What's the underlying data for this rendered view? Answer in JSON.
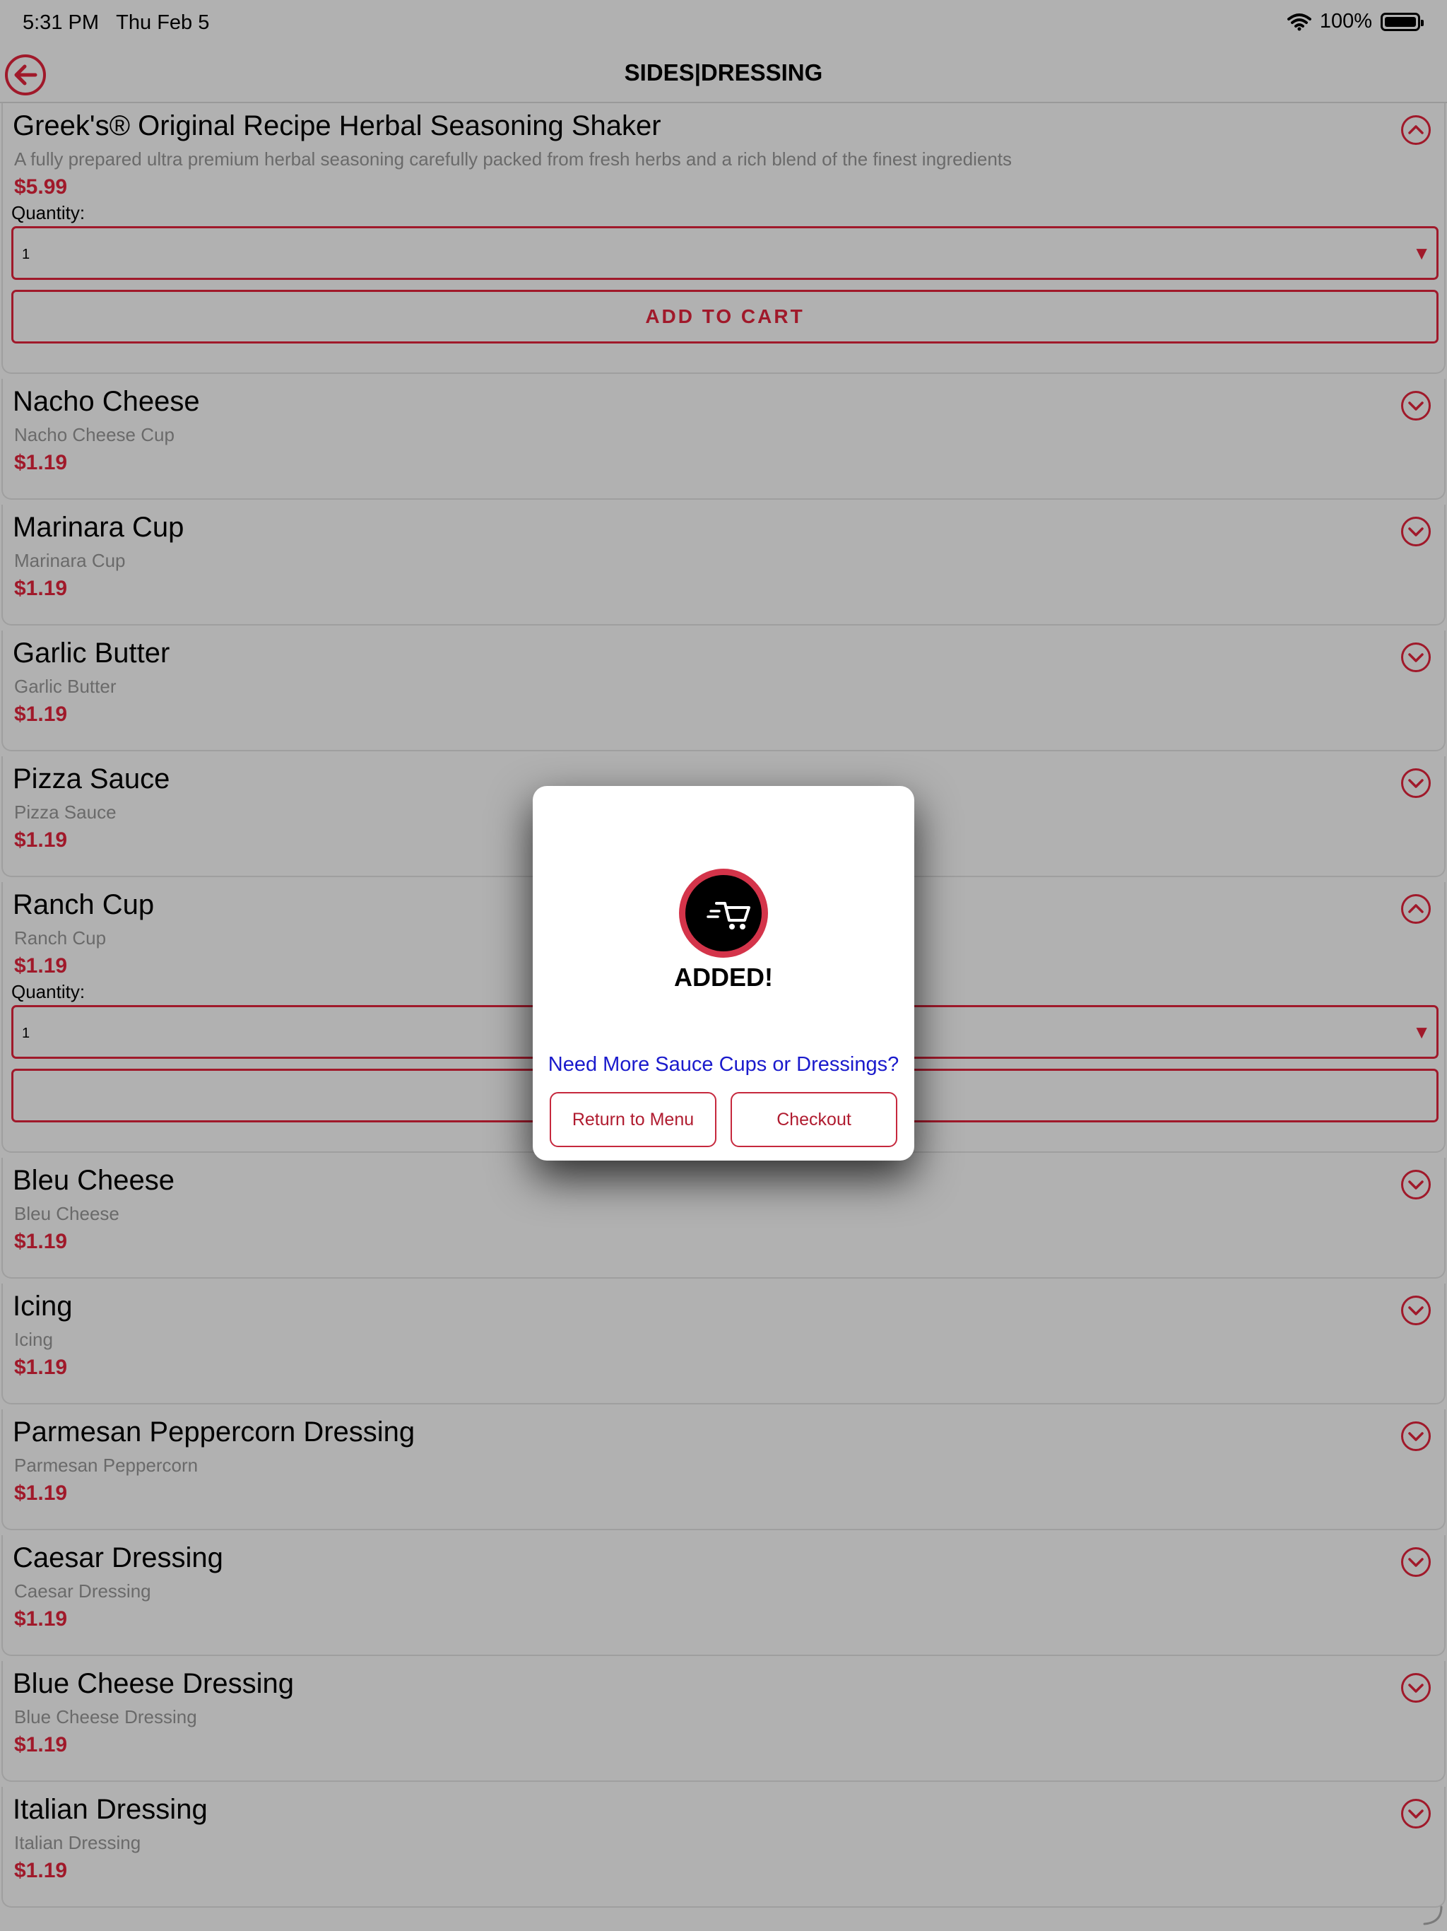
{
  "status_bar": {
    "time": "5:31 PM",
    "date": "Thu Feb 5",
    "battery": "100%"
  },
  "nav": {
    "title": "SIDES|DRESSING",
    "back_icon": "back-arrow-icon"
  },
  "items": [
    {
      "name": "Greek's® Original Recipe Herbal Seasoning Shaker",
      "desc": "A fully prepared ultra premium herbal seasoning carefully packed from fresh herbs and a rich blend of the finest ingredients",
      "price": "$5.99",
      "expanded": true,
      "qty_label": "Quantity:",
      "qty_value": "1",
      "cart_label": "ADD TO CART"
    },
    {
      "name": "Nacho Cheese",
      "desc": "Nacho Cheese Cup",
      "price": "$1.19",
      "expanded": false
    },
    {
      "name": "Marinara Cup",
      "desc": "Marinara Cup",
      "price": "$1.19",
      "expanded": false
    },
    {
      "name": "Garlic Butter",
      "desc": "Garlic Butter",
      "price": "$1.19",
      "expanded": false
    },
    {
      "name": "Pizza Sauce",
      "desc": "Pizza Sauce",
      "price": "$1.19",
      "expanded": false
    },
    {
      "name": "Ranch Cup",
      "desc": "Ranch Cup",
      "price": "$1.19",
      "expanded": true,
      "qty_label": "Quantity:",
      "qty_value": "1",
      "cart_label": ""
    },
    {
      "name": "Bleu Cheese",
      "desc": "Bleu Cheese",
      "price": "$1.19",
      "expanded": false
    },
    {
      "name": "Icing",
      "desc": "Icing",
      "price": "$1.19",
      "expanded": false
    },
    {
      "name": "Parmesan Peppercorn Dressing",
      "desc": "Parmesan Peppercorn",
      "price": "$1.19",
      "expanded": false
    },
    {
      "name": "Caesar Dressing",
      "desc": "Caesar Dressing",
      "price": "$1.19",
      "expanded": false
    },
    {
      "name": "Blue Cheese Dressing",
      "desc": "Blue Cheese Dressing",
      "price": "$1.19",
      "expanded": false
    },
    {
      "name": "Italian Dressing",
      "desc": "Italian Dressing",
      "price": "$1.19",
      "expanded": false
    }
  ],
  "modal": {
    "added_text": "ADDED!",
    "prompt": "Need More Sauce Cups or Dressings?",
    "return_label": "Return to Menu",
    "checkout_label": "Checkout",
    "icon": "cart-icon"
  },
  "colors": {
    "accent": "#a0192a",
    "link": "#1a1acc",
    "overlay_bg": "#b1b1b1"
  }
}
